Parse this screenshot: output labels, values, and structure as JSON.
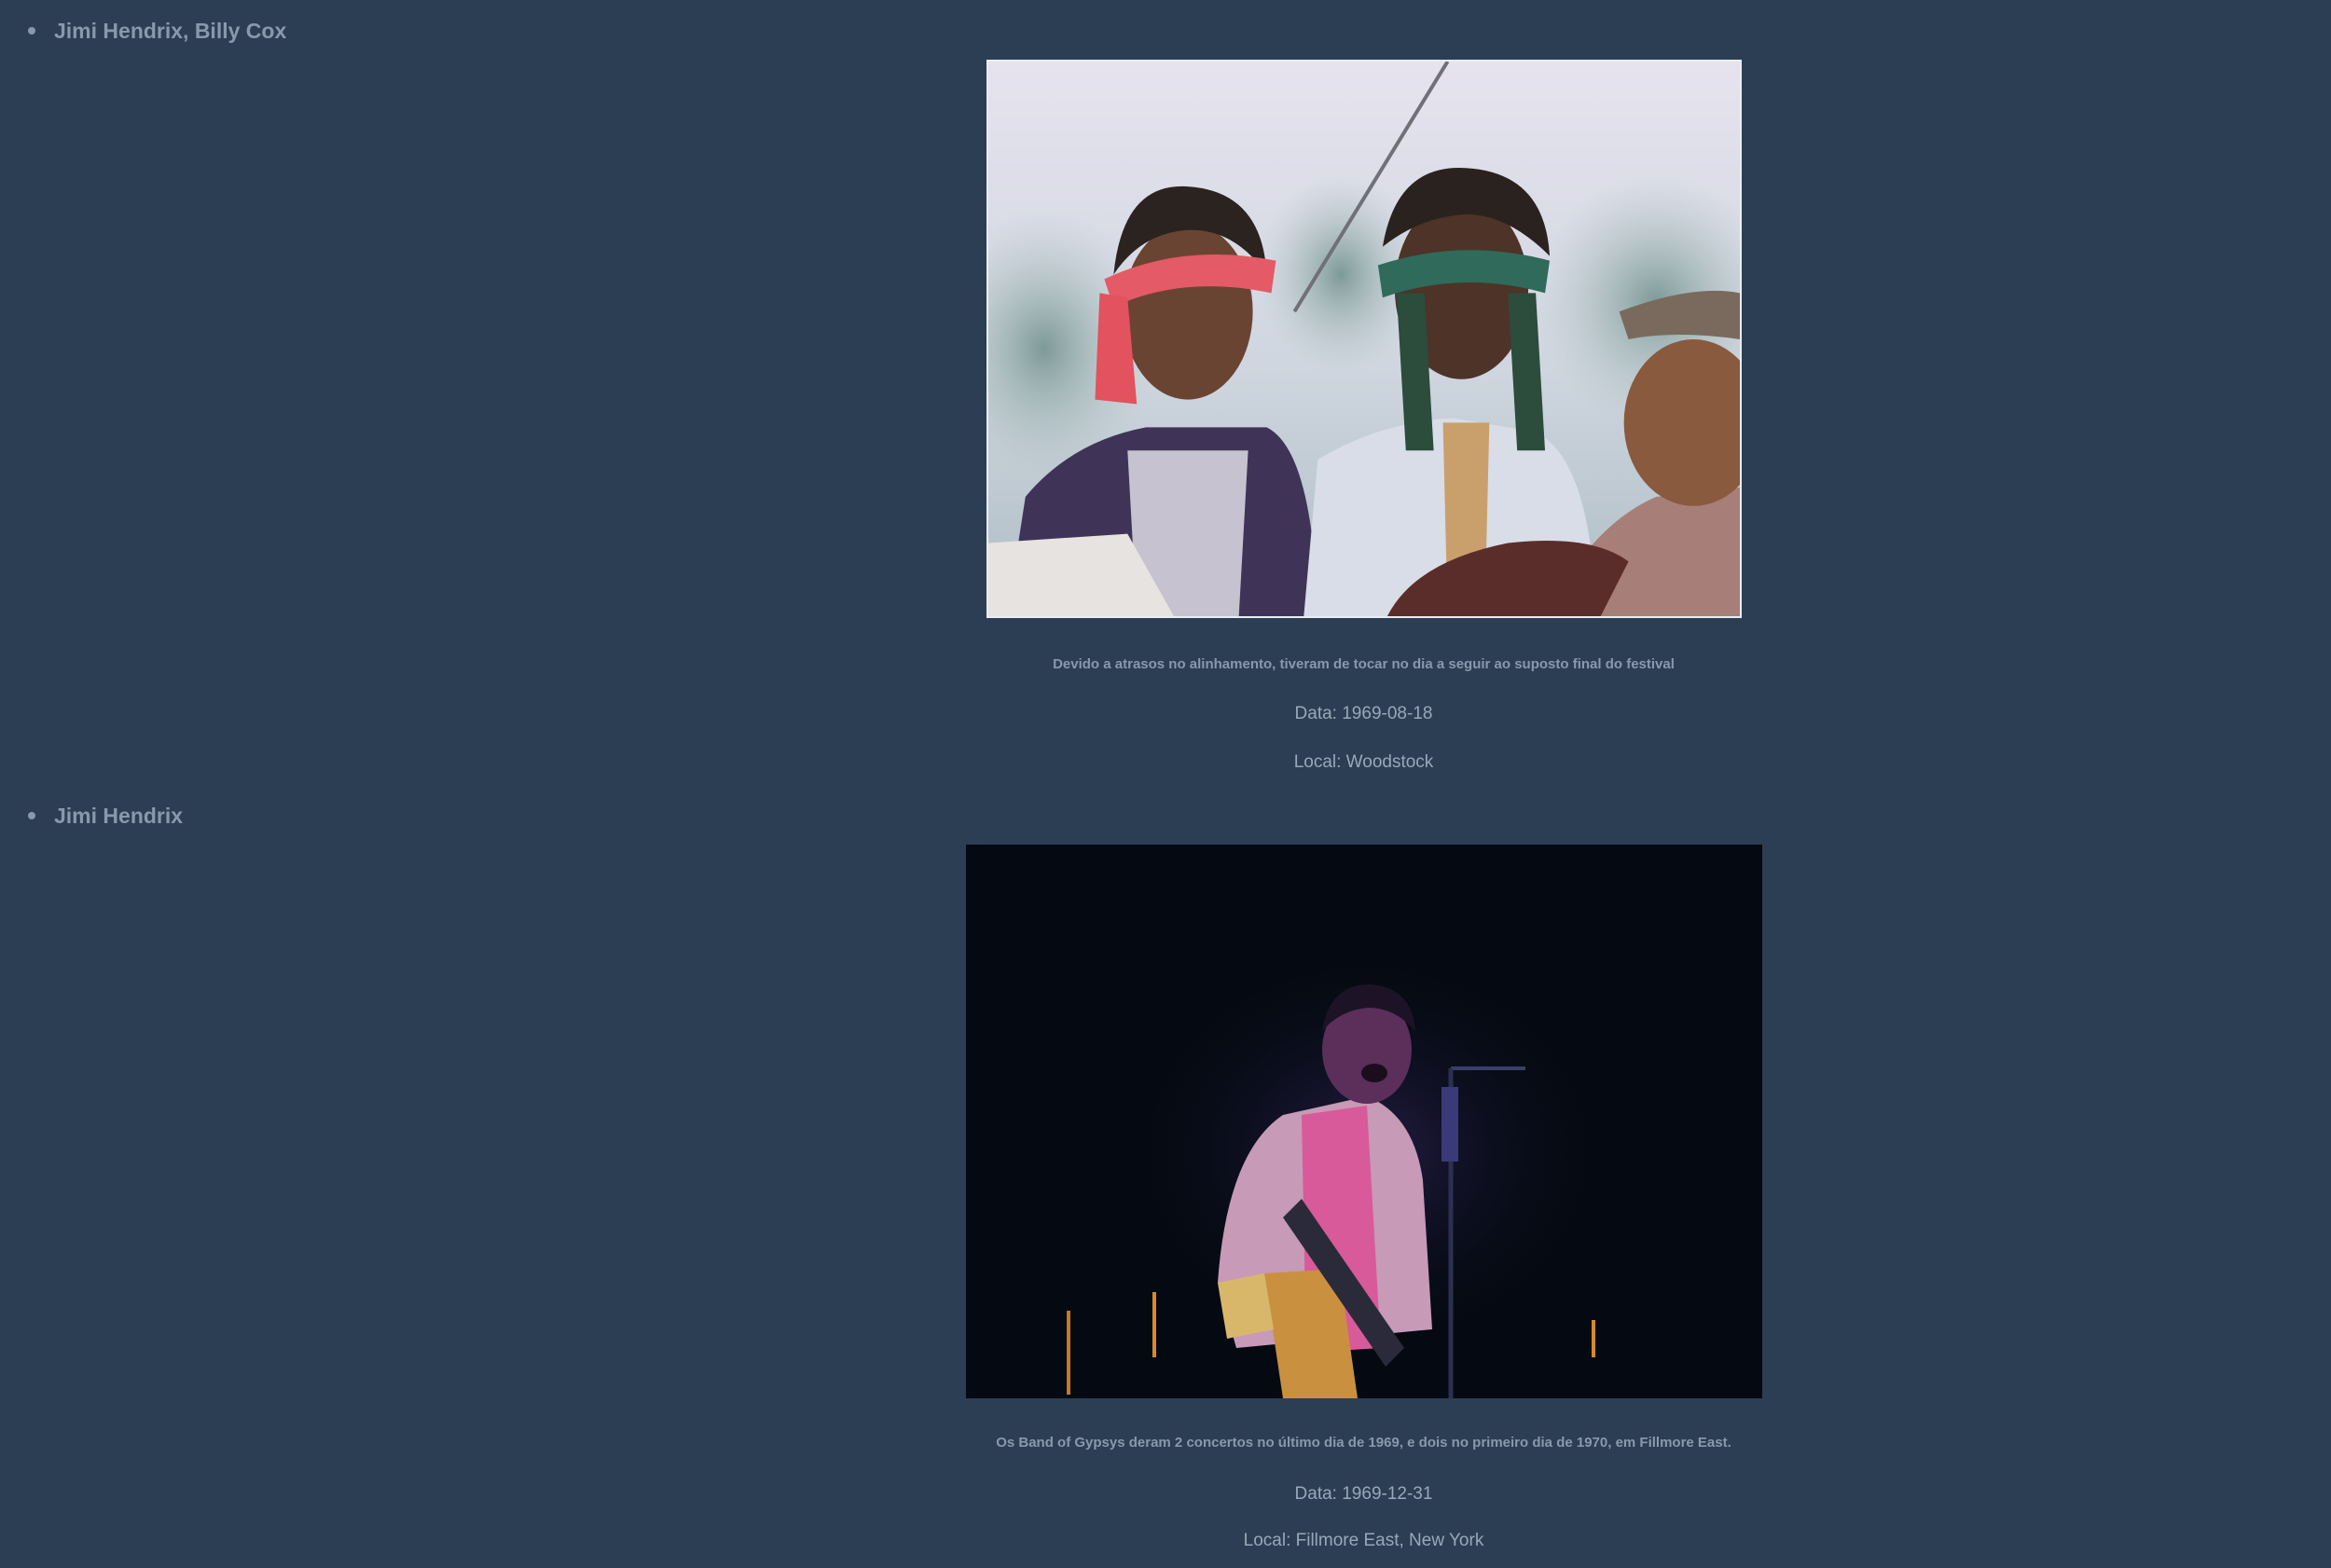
{
  "concerts": [
    {
      "artists": "Jimi Hendrix, Billy Cox",
      "caption": "Devido a atrasos no alinhamento, tiveram de tocar no dia a seguir ao suposto final do festival",
      "date_text": "Data: 1969-08-18",
      "place_text": "Local: Woodstock"
    },
    {
      "artists": "Jimi Hendrix",
      "caption": "Os Band of Gypsys deram 2 concertos no último dia de 1969, e dois no primeiro dia de 1970, em Fillmore East.",
      "date_text": "Data: 1969-12-31",
      "place_text": "Local: Fillmore East, New York"
    }
  ],
  "colors": {
    "page_background": "#2c3e53",
    "text_muted": "#8899ad",
    "photo_border": "#e9edf2"
  }
}
